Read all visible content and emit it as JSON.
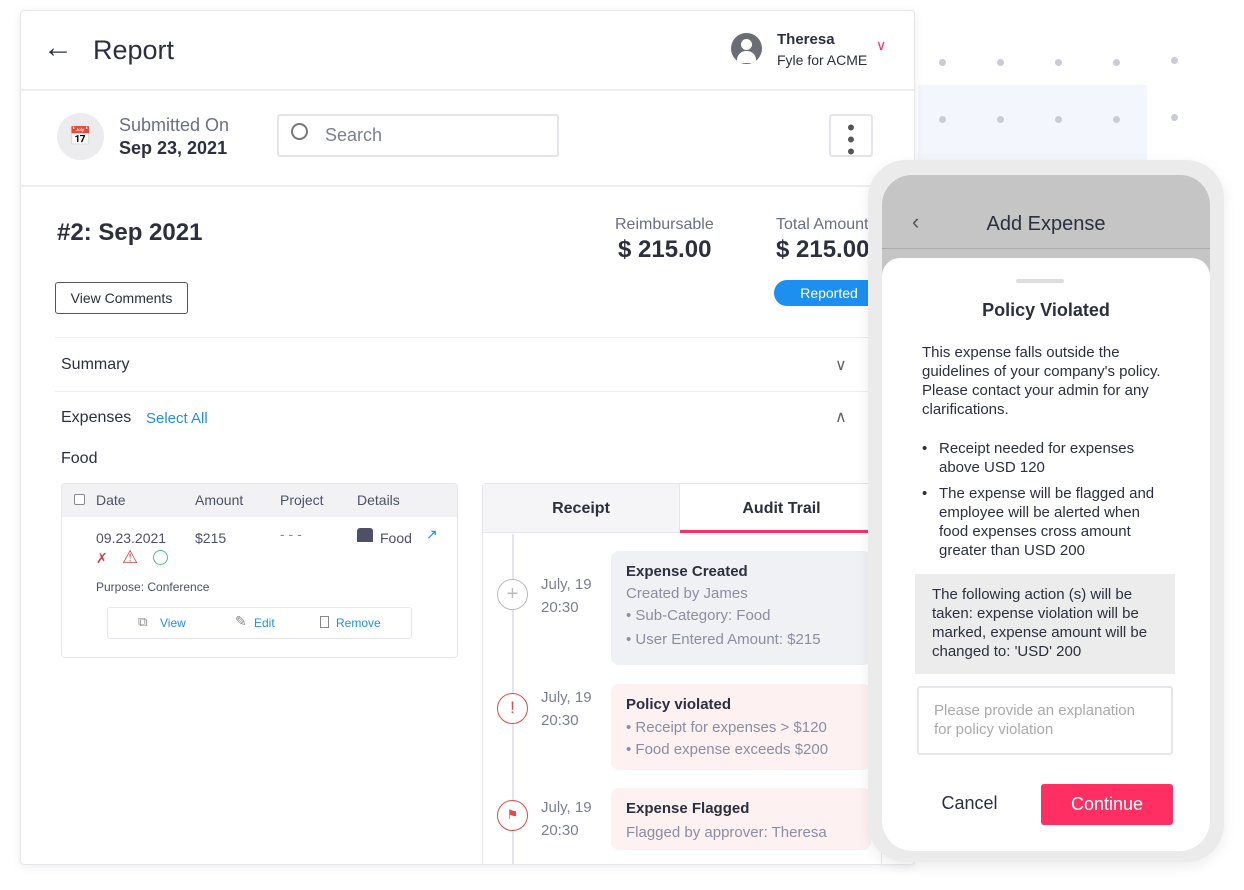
{
  "header": {
    "title": "Report",
    "user_name": "Theresa",
    "user_org": "Fyle for ACME"
  },
  "toolbar": {
    "submitted_label": "Submitted On",
    "submitted_date": "Sep 23, 2021",
    "search_placeholder": "Search"
  },
  "report": {
    "title": "#2: Sep 2021",
    "view_comments": "View Comments",
    "reimbursable_label": "Reimbursable",
    "reimbursable_value": "$ 215.00",
    "total_label": "Total Amount",
    "total_value": "$ 215.00",
    "status": "Reported",
    "status_color": "#1d8ff0"
  },
  "sections": {
    "summary": "Summary",
    "expenses": "Expenses",
    "select_all": "Select All",
    "category": "Food"
  },
  "table": {
    "headers": [
      "Date",
      "Amount",
      "Project",
      "Details"
    ],
    "row": {
      "date": "09.23.2021",
      "amount": "$215",
      "project": "- - -",
      "details": "Food",
      "purpose": "Purpose: Conference",
      "actions": [
        "View",
        "Edit",
        "Remove"
      ]
    }
  },
  "tabs": [
    "Receipt",
    "Audit Trail"
  ],
  "audit": [
    {
      "date": "July, 19",
      "time": "20:30",
      "title": "Expense Created",
      "sub": "Created by James",
      "bullets": [
        "Sub-Category: Food",
        "User Entered Amount: $215"
      ]
    },
    {
      "date": "July, 19",
      "time": "20:30",
      "title": "Policy violated",
      "bullets": [
        "Receipt for expenses > $120",
        "Food expense exceeds $200"
      ]
    },
    {
      "date": "July, 19",
      "time": "20:30",
      "title": "Expense Flagged",
      "sub": "Flagged by approver: Theresa"
    }
  ],
  "phone": {
    "title": "Add Expense",
    "sheet_title": "Policy Violated",
    "description": "This expense falls outside the guidelines of your company's policy. Please contact your admin for any clarifications.",
    "rules": [
      "Receipt needed for expenses above USD 120",
      "The expense will be flagged and employee will be alerted when food expenses cross amount greater than USD 200"
    ],
    "action_note": "The following action (s) will be taken: expense violation will be marked, expense amount will be changed to: 'USD' 200",
    "explanation_placeholder": "Please provide an explanation for policy violation",
    "cancel": "Cancel",
    "continue": "Continue",
    "accent": "#ff2e63"
  }
}
